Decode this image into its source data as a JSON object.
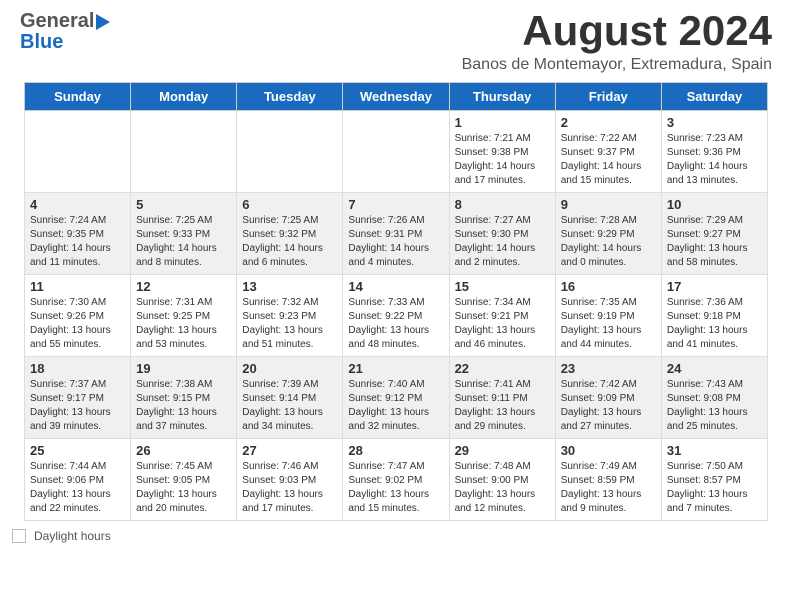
{
  "header": {
    "logo_general": "General",
    "logo_blue": "Blue",
    "month_title": "August 2024",
    "location": "Banos de Montemayor, Extremadura, Spain"
  },
  "calendar": {
    "days": [
      "Sunday",
      "Monday",
      "Tuesday",
      "Wednesday",
      "Thursday",
      "Friday",
      "Saturday"
    ],
    "weeks": [
      {
        "shaded": false,
        "cells": [
          {
            "date": "",
            "info": ""
          },
          {
            "date": "",
            "info": ""
          },
          {
            "date": "",
            "info": ""
          },
          {
            "date": "",
            "info": ""
          },
          {
            "date": "1",
            "info": "Sunrise: 7:21 AM\nSunset: 9:38 PM\nDaylight: 14 hours\nand 17 minutes."
          },
          {
            "date": "2",
            "info": "Sunrise: 7:22 AM\nSunset: 9:37 PM\nDaylight: 14 hours\nand 15 minutes."
          },
          {
            "date": "3",
            "info": "Sunrise: 7:23 AM\nSunset: 9:36 PM\nDaylight: 14 hours\nand 13 minutes."
          }
        ]
      },
      {
        "shaded": true,
        "cells": [
          {
            "date": "4",
            "info": "Sunrise: 7:24 AM\nSunset: 9:35 PM\nDaylight: 14 hours\nand 11 minutes."
          },
          {
            "date": "5",
            "info": "Sunrise: 7:25 AM\nSunset: 9:33 PM\nDaylight: 14 hours\nand 8 minutes."
          },
          {
            "date": "6",
            "info": "Sunrise: 7:25 AM\nSunset: 9:32 PM\nDaylight: 14 hours\nand 6 minutes."
          },
          {
            "date": "7",
            "info": "Sunrise: 7:26 AM\nSunset: 9:31 PM\nDaylight: 14 hours\nand 4 minutes."
          },
          {
            "date": "8",
            "info": "Sunrise: 7:27 AM\nSunset: 9:30 PM\nDaylight: 14 hours\nand 2 minutes."
          },
          {
            "date": "9",
            "info": "Sunrise: 7:28 AM\nSunset: 9:29 PM\nDaylight: 14 hours\nand 0 minutes."
          },
          {
            "date": "10",
            "info": "Sunrise: 7:29 AM\nSunset: 9:27 PM\nDaylight: 13 hours\nand 58 minutes."
          }
        ]
      },
      {
        "shaded": false,
        "cells": [
          {
            "date": "11",
            "info": "Sunrise: 7:30 AM\nSunset: 9:26 PM\nDaylight: 13 hours\nand 55 minutes."
          },
          {
            "date": "12",
            "info": "Sunrise: 7:31 AM\nSunset: 9:25 PM\nDaylight: 13 hours\nand 53 minutes."
          },
          {
            "date": "13",
            "info": "Sunrise: 7:32 AM\nSunset: 9:23 PM\nDaylight: 13 hours\nand 51 minutes."
          },
          {
            "date": "14",
            "info": "Sunrise: 7:33 AM\nSunset: 9:22 PM\nDaylight: 13 hours\nand 48 minutes."
          },
          {
            "date": "15",
            "info": "Sunrise: 7:34 AM\nSunset: 9:21 PM\nDaylight: 13 hours\nand 46 minutes."
          },
          {
            "date": "16",
            "info": "Sunrise: 7:35 AM\nSunset: 9:19 PM\nDaylight: 13 hours\nand 44 minutes."
          },
          {
            "date": "17",
            "info": "Sunrise: 7:36 AM\nSunset: 9:18 PM\nDaylight: 13 hours\nand 41 minutes."
          }
        ]
      },
      {
        "shaded": true,
        "cells": [
          {
            "date": "18",
            "info": "Sunrise: 7:37 AM\nSunset: 9:17 PM\nDaylight: 13 hours\nand 39 minutes."
          },
          {
            "date": "19",
            "info": "Sunrise: 7:38 AM\nSunset: 9:15 PM\nDaylight: 13 hours\nand 37 minutes."
          },
          {
            "date": "20",
            "info": "Sunrise: 7:39 AM\nSunset: 9:14 PM\nDaylight: 13 hours\nand 34 minutes."
          },
          {
            "date": "21",
            "info": "Sunrise: 7:40 AM\nSunset: 9:12 PM\nDaylight: 13 hours\nand 32 minutes."
          },
          {
            "date": "22",
            "info": "Sunrise: 7:41 AM\nSunset: 9:11 PM\nDaylight: 13 hours\nand 29 minutes."
          },
          {
            "date": "23",
            "info": "Sunrise: 7:42 AM\nSunset: 9:09 PM\nDaylight: 13 hours\nand 27 minutes."
          },
          {
            "date": "24",
            "info": "Sunrise: 7:43 AM\nSunset: 9:08 PM\nDaylight: 13 hours\nand 25 minutes."
          }
        ]
      },
      {
        "shaded": false,
        "cells": [
          {
            "date": "25",
            "info": "Sunrise: 7:44 AM\nSunset: 9:06 PM\nDaylight: 13 hours\nand 22 minutes."
          },
          {
            "date": "26",
            "info": "Sunrise: 7:45 AM\nSunset: 9:05 PM\nDaylight: 13 hours\nand 20 minutes."
          },
          {
            "date": "27",
            "info": "Sunrise: 7:46 AM\nSunset: 9:03 PM\nDaylight: 13 hours\nand 17 minutes."
          },
          {
            "date": "28",
            "info": "Sunrise: 7:47 AM\nSunset: 9:02 PM\nDaylight: 13 hours\nand 15 minutes."
          },
          {
            "date": "29",
            "info": "Sunrise: 7:48 AM\nSunset: 9:00 PM\nDaylight: 13 hours\nand 12 minutes."
          },
          {
            "date": "30",
            "info": "Sunrise: 7:49 AM\nSunset: 8:59 PM\nDaylight: 13 hours\nand 9 minutes."
          },
          {
            "date": "31",
            "info": "Sunrise: 7:50 AM\nSunset: 8:57 PM\nDaylight: 13 hours\nand 7 minutes."
          }
        ]
      }
    ]
  },
  "footer": {
    "daylight_label": "Daylight hours"
  }
}
